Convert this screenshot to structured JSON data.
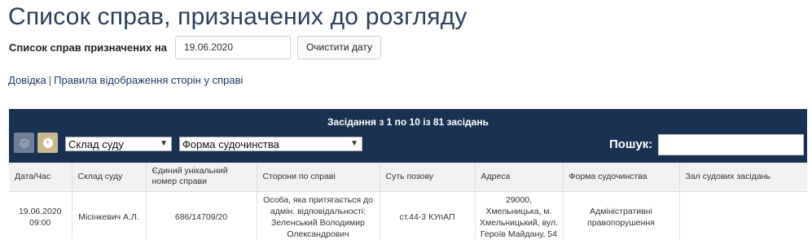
{
  "page": {
    "title": "Список справ, призначених до розгляду"
  },
  "date_filter": {
    "label": "Список справ призначених на",
    "value": "19.06.2020",
    "clear_label": "Очистити дату"
  },
  "links": {
    "help": "Довідка",
    "separator": "|",
    "rules": "Правила відображення сторін у справі"
  },
  "panel": {
    "caption": "Засідання з 1 по 10 із 81 засідань",
    "court_select": "Склад суду",
    "form_select": "Форма судочинства",
    "search_label": "Пошук:",
    "search_value": "",
    "icons": [
      "collapse-icon",
      "expand-icon"
    ]
  },
  "table": {
    "columns": [
      "Дата/Час",
      "Склад суду",
      "Єдиний унікальний номер справи",
      "Сторони по справі",
      "Суть позову",
      "Адреса",
      "Форма судочинства",
      "Зал судових засідань"
    ],
    "rows": [
      {
        "datetime": "19.06.2020 09:00",
        "judge": "Місінкевич А.Л.",
        "case_number": "686/14709/20",
        "parties": "Особа, яка притягається до адмін. відповідальності: Зеленський Володимир Олександрович",
        "claim": "ст.44-3 КУпАП",
        "address": "29000, Хмельницька, м. Хмельницький, вул. Героїв Майдану, 54",
        "form": "Адміністративні правопорушення",
        "hall": ""
      }
    ]
  },
  "colors": {
    "panel_bg": "#193153",
    "title": "#2a3f5a",
    "active_button": "#c9b98f"
  }
}
